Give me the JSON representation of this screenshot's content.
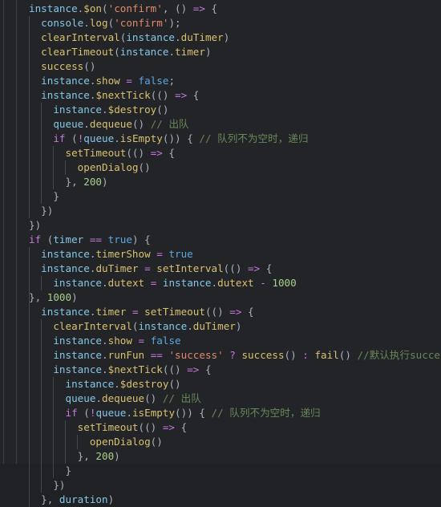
{
  "editor": {
    "language": "javascript",
    "theme": "dark",
    "background_color": "#222427",
    "indent_guide_color": "#44474b",
    "colors": {
      "variable": "#85c7e8",
      "property": "#d8c171",
      "string": "#e08a6b",
      "number": "#a8d08a",
      "keyword": "#c678dd",
      "boolean": "#5aa7e0",
      "punctuation": "#a9b2bd",
      "comment": "#6a8759",
      "plain": "#bfc6cf"
    }
  },
  "code": {
    "lines": [
      "instance.$on('confirm', () => {",
      "  console.log('confirm');",
      "  clearInterval(instance.duTimer)",
      "  clearTimeout(instance.timer)",
      "  success()",
      "  instance.show = false;",
      "  instance.$nextTick(() => {",
      "    instance.$destroy()",
      "    queue.dequeue() // 出队",
      "    if (!queue.isEmpty()) { // 队列不为空时，递归",
      "      setTimeout(() => {",
      "        openDialog()",
      "      }, 200)",
      "    }",
      "  })",
      "})",
      "if (timer == true) {",
      "  instance.timerShow = true",
      "  instance.duTimer = setInterval(() => {",
      "    instance.dutext = instance.dutext - 1000",
      "  }, 1000)",
      "  instance.timer = setTimeout(() => {",
      "    clearInterval(instance.duTimer)",
      "    instance.show = false",
      "    instance.runFun == 'success' ? success() : fail() //默认执行success方法",
      "    instance.$nextTick(() => {",
      "      instance.$destroy()",
      "      queue.dequeue() // 出队",
      "      if (!queue.isEmpty()) { // 队列不为空时，递归",
      "        setTimeout(() => {",
      "          openDialog()",
      "        }, 200)",
      "      }",
      "    })",
      "  }, duration)"
    ],
    "comments": [
      "// 出队",
      "// 队列不为空时，递归",
      "//默认执行success方法"
    ],
    "numbers": [
      "200",
      "1000",
      "1000"
    ],
    "strings": [
      "'confirm'",
      "'confirm'",
      "'success'"
    ],
    "identifiers": [
      "instance",
      "console",
      "queue",
      "timer",
      "duration",
      "success",
      "fail",
      "openDialog",
      "setTimeout",
      "setInterval",
      "clearInterval",
      "clearTimeout"
    ]
  },
  "rails": [
    {
      "name": "viewport-rail-1",
      "x": 4
    },
    {
      "name": "viewport-rail-2",
      "x": 20
    }
  ]
}
